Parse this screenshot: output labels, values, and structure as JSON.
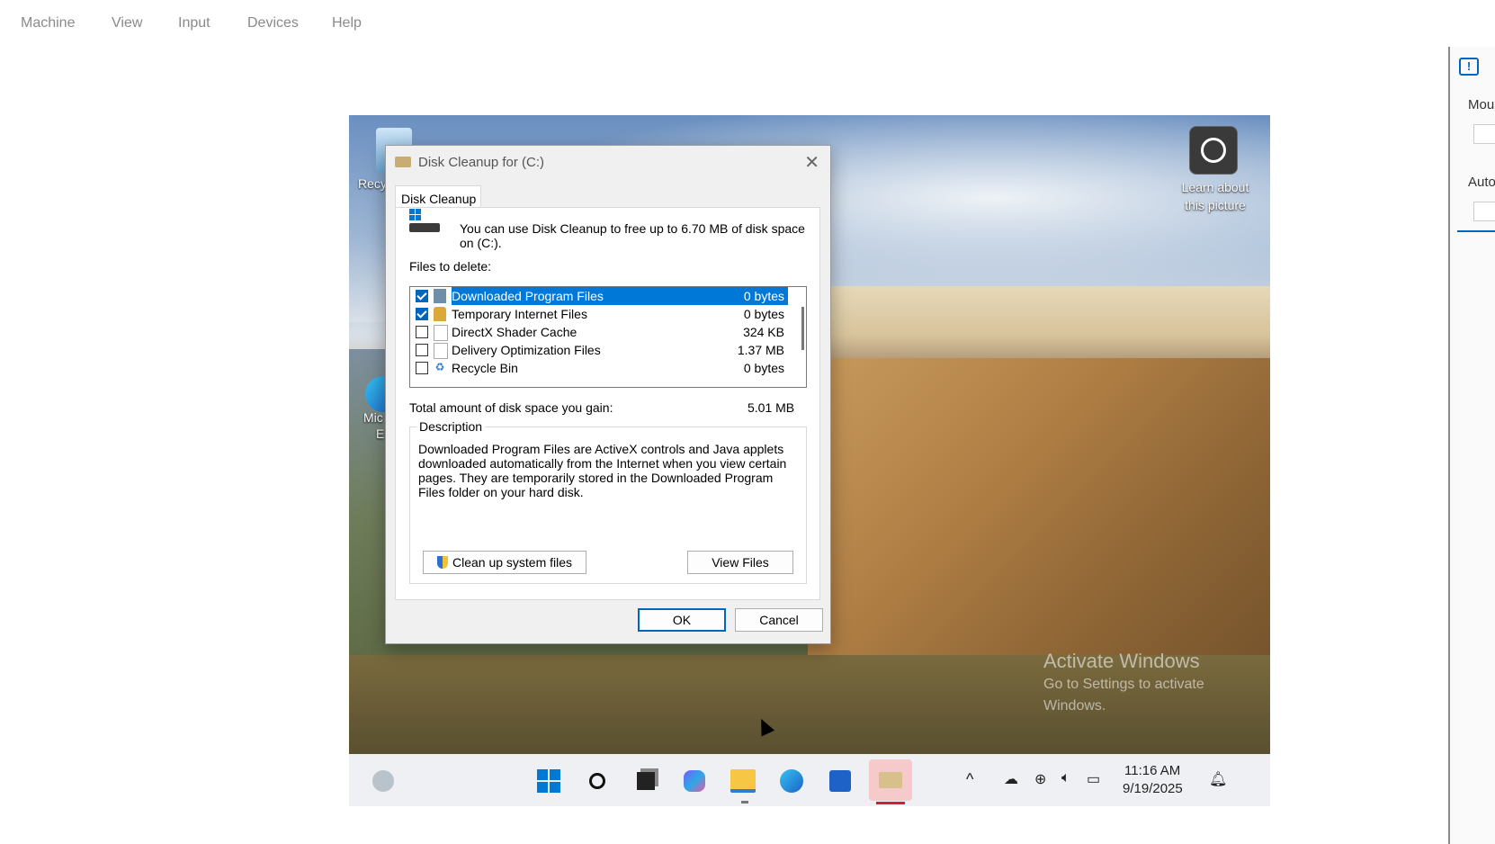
{
  "menu": [
    "Machine",
    "View",
    "Input",
    "Devices",
    "Help"
  ],
  "desktop": {
    "recycle_label": "Recy",
    "edge_label_1": "Mic",
    "edge_label_2": "E",
    "learn_line1": "Learn about",
    "learn_line2": "this picture",
    "activate_title": "Activate Windows",
    "activate_line1": "Go to Settings to activate",
    "activate_line2": "Windows."
  },
  "dialog": {
    "title": "Disk Cleanup for  (C:)",
    "close": "✕",
    "tab": "Disk Cleanup",
    "intro": "You can use Disk Cleanup to free up to 6.70 MB of disk space on (C:).",
    "files_label": "Files to delete:",
    "files": [
      {
        "name": "Downloaded Program Files",
        "size": "0 bytes",
        "checked": true,
        "selected": true
      },
      {
        "name": "Temporary Internet Files",
        "size": "0 bytes",
        "checked": true,
        "selected": false
      },
      {
        "name": "DirectX Shader Cache",
        "size": "324 KB",
        "checked": false,
        "selected": false
      },
      {
        "name": "Delivery Optimization Files",
        "size": "1.37 MB",
        "checked": false,
        "selected": false
      },
      {
        "name": "Recycle Bin",
        "size": "0 bytes",
        "checked": false,
        "selected": false
      }
    ],
    "total_label": "Total amount of disk space you gain:",
    "total_value": "5.01 MB",
    "desc_title": "Description",
    "desc_text": "Downloaded Program Files are ActiveX controls and Java applets downloaded automatically from the Internet when you view certain pages. They are temporarily stored in the Downloaded Program Files folder on your hard disk.",
    "cleanup_btn": "Clean up system files",
    "view_btn": "View Files",
    "ok_btn": "OK",
    "cancel_btn": "Cancel"
  },
  "taskbar": {
    "time": "11:16 AM",
    "date": "9/19/2025"
  },
  "right_panel": {
    "label1": "Mou",
    "label2": "Auto"
  }
}
